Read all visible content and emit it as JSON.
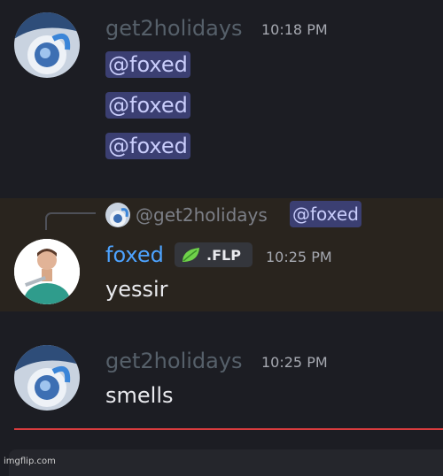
{
  "messages": [
    {
      "author": "get2holidays",
      "timestamp": "10:18 PM",
      "mentions": [
        "@foxed",
        "@foxed",
        "@foxed"
      ]
    },
    {
      "reply_to": {
        "author": "@get2holidays",
        "mention": "@foxed"
      },
      "author": "foxed",
      "role_badge": ".FLP",
      "timestamp": "10:25 PM",
      "text": "yessir"
    },
    {
      "author": "get2holidays",
      "timestamp": "10:25 PM",
      "text": "smells"
    }
  ],
  "colors": {
    "background": "#1c1d23",
    "highlight": "#29241e",
    "author_get2holidays": "#56606a",
    "author_foxed": "#4da3ff",
    "mention_bg": "#3b3f72",
    "mention_text": "#c9cdfb",
    "new_messages_divider": "#d83c3e"
  },
  "watermark": "imgflip.com"
}
